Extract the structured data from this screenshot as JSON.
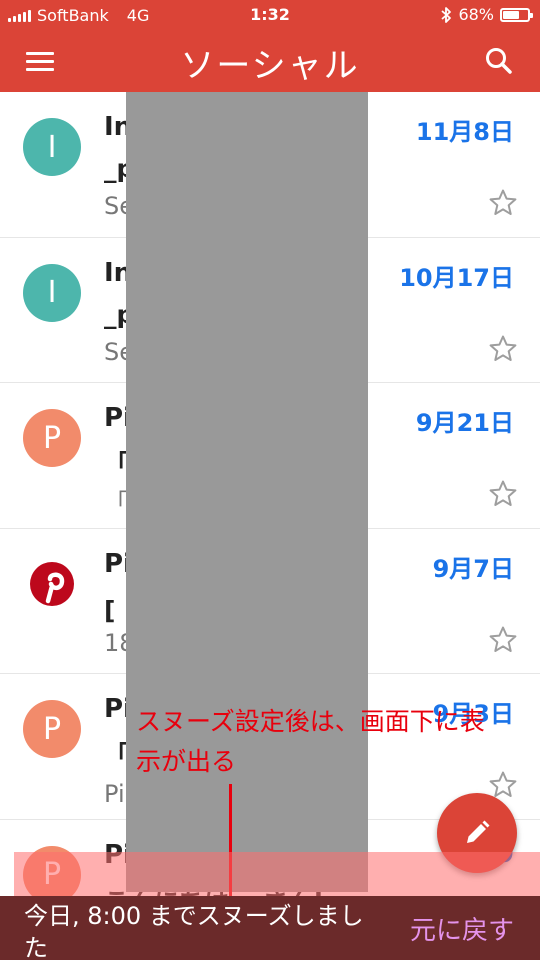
{
  "status_bar": {
    "carrier": "SoftBank",
    "network": "4G",
    "time": "1:32",
    "bluetooth_icon": "bluetooth-icon",
    "battery_percent": "68%",
    "battery_level": 0.68
  },
  "app_bar": {
    "title": "ソーシャル",
    "menu_icon": "hamburger-menu-icon",
    "search_icon": "search-icon"
  },
  "emails": [
    {
      "avatar_letter": "I",
      "avatar_color": "#4db6ac",
      "sender": "In",
      "date": "11月8日",
      "subject": "_p                       ew po…",
      "snippet": "Se                       e miss…"
    },
    {
      "avatar_letter": "I",
      "avatar_color": "#4db6ac",
      "sender": "In",
      "date": "10月17日",
      "subject": "_p                       ew po…",
      "snippet": "Se                       e miss…"
    },
    {
      "avatar_letter": "P",
      "avatar_color": "#f28b6b",
      "sender": "Pi",
      "date": "9月21日",
      "subject": "「                       ヒン…",
      "snippet": "「                     」で…"
    },
    {
      "avatar_letter": "",
      "avatar_color": "#bd081c",
      "sender": "Pi",
      "date": "9月7日",
      "subject": "[                        アイ…",
      "snippet": "18                     017 ho…"
    },
    {
      "avatar_letter": "P",
      "avatar_color": "#f28b6b",
      "sender": "Pi",
      "date": "9月3日",
      "subject": "「                       イラ…",
      "snippet": "Pi                      をチェ…"
    },
    {
      "avatar_letter": "P",
      "avatar_color": "#f28b6b",
      "sender": "Pi",
      "date": "9",
      "subject": "こんにちは、              さん!",
      "snippet": ""
    }
  ],
  "annotation": {
    "text": "スヌーズ設定後は、画面下に表示が出る",
    "color": "#e8000d"
  },
  "fab": {
    "icon": "pencil-compose-icon"
  },
  "snackbar": {
    "message": "今日, 8:00 までスヌーズしました",
    "action": "元に戻す"
  },
  "colors": {
    "brand_red": "#db4437",
    "date_blue": "#1a73e8",
    "redaction_gray": "#999999"
  }
}
